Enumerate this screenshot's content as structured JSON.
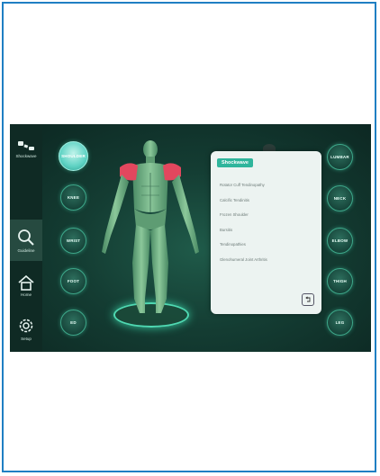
{
  "sidebar": {
    "items": [
      {
        "label": "Shockwave",
        "icon": "shockwave-applicator-icon"
      },
      {
        "label": "Guideline",
        "icon": "search-icon"
      },
      {
        "label": "Home",
        "icon": "home-icon"
      },
      {
        "label": "Setup",
        "icon": "gear-icon"
      }
    ]
  },
  "regions": {
    "shoulder": "SHOULDER",
    "knee": "KNEE",
    "wrist": "WRIST",
    "foot": "FOOT",
    "ed": "ED",
    "lumbar": "LUMBAR",
    "neck": "NECK",
    "elbow": "ELBOW",
    "thigh": "THIGH",
    "leg": "LEG"
  },
  "panel": {
    "title": "Shockwave",
    "items": [
      "Rotator Cuff Tendinopathy",
      "Calcific Tendinitis",
      "Frozen Shoulder",
      "Bursitis",
      "Tendinopathies",
      "Glenohumeral Joint Arthritis"
    ],
    "back_icon": "return-icon"
  },
  "colors": {
    "accent": "#2fb59c",
    "highlight_muscle": "#e2475e",
    "frame": "#1f7fc3"
  }
}
